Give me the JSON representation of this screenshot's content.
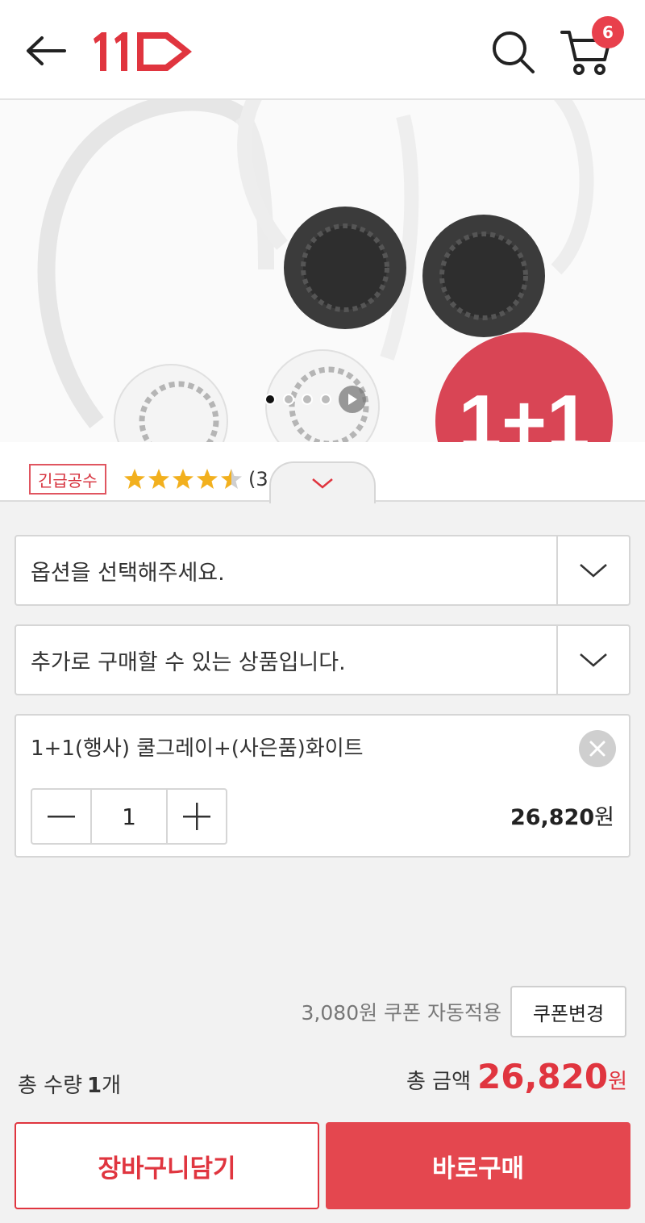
{
  "header": {
    "logo_text": "11",
    "cart_count": "6"
  },
  "hero": {
    "badge_text": "1+1",
    "slides_count": 4,
    "active_slide": 1
  },
  "product_strip": {
    "tag": "긴급공수",
    "rating_stars": 4.5,
    "rating_count": "(3"
  },
  "options": {
    "option_select_placeholder": "옵션을 선택해주세요.",
    "addon_select_placeholder": "추가로 구매할 수 있는 상품입니다."
  },
  "selected_item": {
    "name": "1+1(행사) 쿨그레이+(사은품)화이트",
    "quantity": "1",
    "price": "26,820",
    "price_unit": "원"
  },
  "coupon": {
    "text": "3,080원 쿠폰 자동적용",
    "change_label": "쿠폰변경"
  },
  "totals": {
    "qty_label": "총 수량",
    "qty_value": "1",
    "qty_unit": "개",
    "amount_label": "총 금액",
    "amount_value": "26,820",
    "amount_unit": "원"
  },
  "actions": {
    "add_to_cart": "장바구니담기",
    "buy_now": "바로구매"
  },
  "colors": {
    "brand_red": "#e0353f",
    "badge_red": "#e8404c"
  }
}
